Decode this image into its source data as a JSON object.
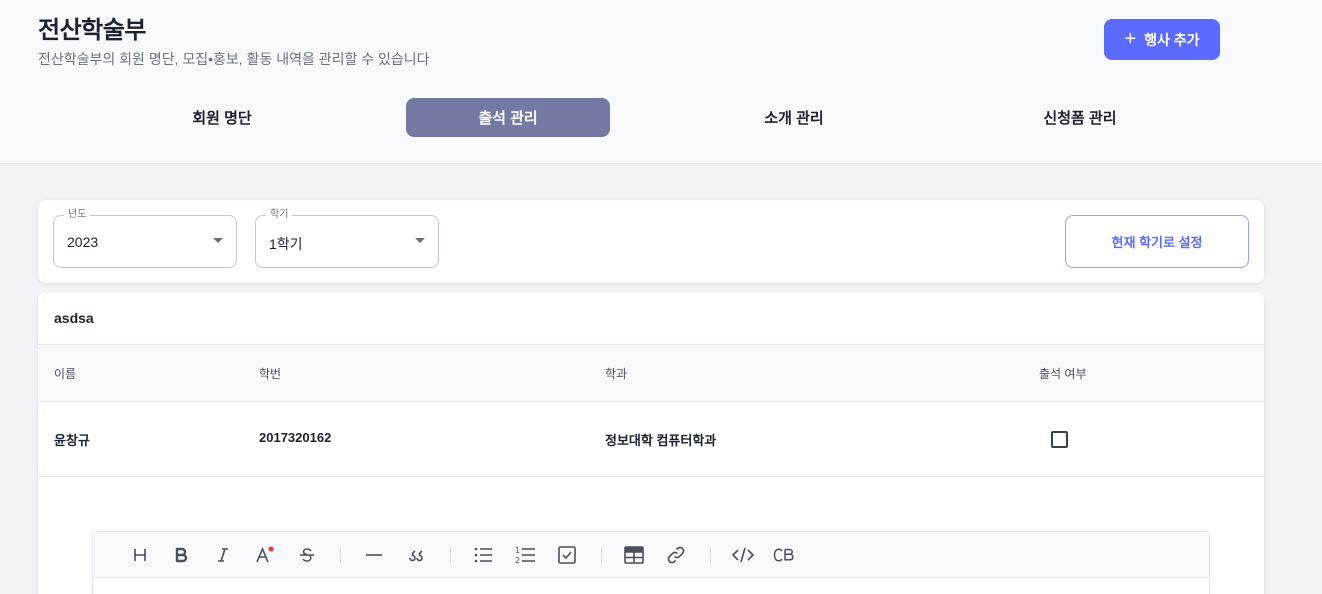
{
  "header": {
    "title": "전산학술부",
    "subtitle": "전산학술부의 회원 명단, 모집•홍보, 활동 내역을 관리할 수 있습니다",
    "add_event_label": "행사 추가",
    "add_event_icon": "plus-icon"
  },
  "tabs": [
    {
      "label": "회원 명단",
      "active": false
    },
    {
      "label": "출석 관리",
      "active": true
    },
    {
      "label": "소개 관리",
      "active": false
    },
    {
      "label": "신청폼 관리",
      "active": false
    }
  ],
  "filters": {
    "year": {
      "legend": "년도",
      "value": "2023"
    },
    "semester": {
      "legend": "학기",
      "value": "1학기"
    },
    "set_current_label": "현재 학기로 설정"
  },
  "event": {
    "title": "asdsa",
    "columns": [
      "이름",
      "학번",
      "학과",
      "출석 여부"
    ],
    "rows": [
      {
        "name": "윤창규",
        "student_id": "2017320162",
        "department": "정보대학 컴퓨터학과",
        "attended": false
      }
    ]
  },
  "editor": {
    "toolbar": [
      "heading",
      "bold",
      "italic",
      "text-color",
      "strike",
      "horizontal-rule",
      "quote",
      "bullet-list",
      "ordered-list",
      "task-list",
      "table",
      "link",
      "code",
      "code-block"
    ]
  },
  "colors": {
    "accent": "#5b6bff",
    "active_tab": "#727aa3",
    "background": "#f1f3f6",
    "text_color_dot": "#e53935"
  }
}
